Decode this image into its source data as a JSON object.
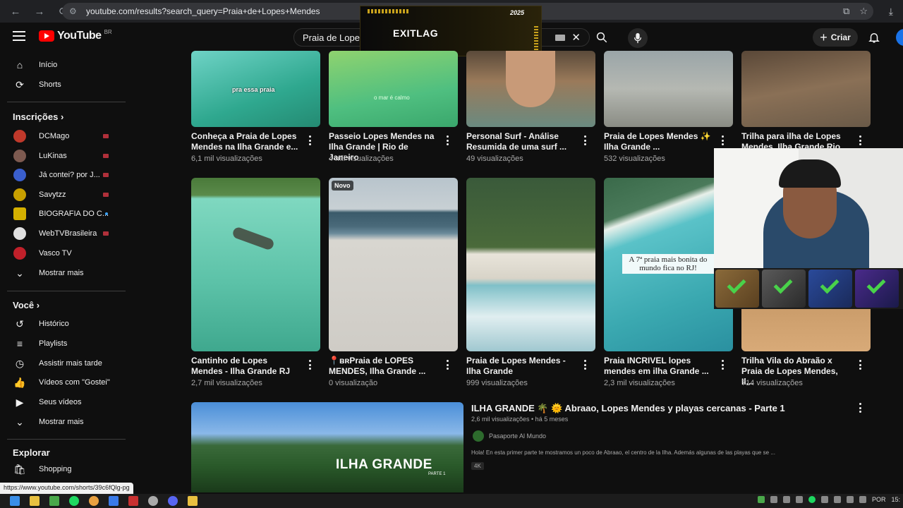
{
  "browser": {
    "url": "youtube.com/results?search_query=Praia+de+Lopes+Mendes",
    "status_link": "https://www.youtube.com/shorts/39c6fQlg-pg"
  },
  "header": {
    "logo_text": "YouTube",
    "country_code": "BR",
    "search_value": "Praia de Lopes",
    "create_label": "Criar"
  },
  "exitlag": {
    "brand": "EXITLAG",
    "tag": "2025"
  },
  "sidebar": {
    "main": [
      {
        "label": "Início",
        "icon": "home-icon"
      },
      {
        "label": "Shorts",
        "icon": "shorts-icon"
      }
    ],
    "subscriptions_heading": "Inscrições",
    "subscriptions": [
      {
        "label": "DCMago",
        "color": "#c0392b",
        "indicator": "live"
      },
      {
        "label": "LuKinas",
        "color": "#7d5a50",
        "indicator": "live"
      },
      {
        "label": "Já contei? por J...",
        "color": "#3a5fcd",
        "indicator": "live"
      },
      {
        "label": "Savytzz",
        "color": "#c8a000",
        "indicator": "live"
      },
      {
        "label": "BIOGRAFIA DO C...",
        "color": "#d4b000",
        "indicator": "dot"
      },
      {
        "label": "WebTVBrasileira",
        "color": "#e0e0e0",
        "indicator": "live"
      },
      {
        "label": "Vasco TV",
        "color": "#c0202a",
        "indicator": "none"
      }
    ],
    "show_more": "Mostrar mais",
    "you_heading": "Você",
    "you_items": [
      {
        "label": "Histórico",
        "icon": "history-icon"
      },
      {
        "label": "Playlists",
        "icon": "playlists-icon"
      },
      {
        "label": "Assistir mais tarde",
        "icon": "watch-later-icon"
      },
      {
        "label": "Vídeos com \"Gostei\"",
        "icon": "like-icon"
      },
      {
        "label": "Seus vídeos",
        "icon": "your-videos-icon"
      },
      {
        "label": "Mostrar mais",
        "icon": "chevron-down-icon"
      }
    ],
    "explore_heading": "Explorar",
    "explore_items": [
      {
        "label": "Shopping",
        "icon": "shopping-icon"
      }
    ]
  },
  "shorts_row1": [
    {
      "title": "Conheça a Praia de Lopes Mendes na Ilha Grande e...",
      "views": "6,1 mil visualizações",
      "overlay": "pra essa praia"
    },
    {
      "title": "Passeio Lopes Mendes na Ilha Grande | Rio de Janeiro",
      "views": "4 mil visualizações",
      "overlay": "o mar é calmo"
    },
    {
      "title": "Personal Surf - Análise Resumida de uma surf ...",
      "views": "49 visualizações",
      "overlay": ""
    },
    {
      "title": "Praia de Lopes Mendes ✨ Ilha Grande          ...",
      "views": "532 visualizações",
      "overlay": ""
    },
    {
      "title": "Trilha para ilha de Lopes Mendes, Ilha Grande Rio d...",
      "views": "",
      "overlay": ""
    }
  ],
  "shorts_row2": [
    {
      "title": "Cantinho  de Lopes Mendes - Ilha Grande RJ",
      "views": "2,7 mil visualizações",
      "badge": ""
    },
    {
      "title": "📍ʙʀPraia de LOPES MENDES, Ilha Grande ...",
      "views": "0 visualização",
      "badge": "Novo"
    },
    {
      "title": "Praia de Lopes Mendes - Ilha Grande",
      "views": "999 visualizações",
      "badge": ""
    },
    {
      "title": "Praia INCRIVEL lopes mendes em ilha Grande ...",
      "views": "2,3 mil visualizações",
      "badge": "",
      "overlay": "A 7ª praia mais bonita do mundo fica no RJ!"
    },
    {
      "title": "Trilha Vila do Abraão x Praia de Lopes Mendes, Il...",
      "views": "714 visualizações",
      "badge": ""
    }
  ],
  "long_result": {
    "title": "ILHA GRANDE 🌴 🌞 Abraao, Lopes Mendes y playas cercanas - Parte 1",
    "meta": "2,6 mil visualizações  •  há 5 meses",
    "channel": "Pasaporte Al Mundo",
    "description": "Hola! En esta primer parte te mostramos un poco de Abraao, el centro de la Ilha. Además algunas de las playas que se ...",
    "badge": "4K",
    "thumb_title": "ILHA GRANDE",
    "thumb_sub": "PARTE 1"
  },
  "taskbar": {
    "lang": "POR",
    "time": "15:"
  }
}
